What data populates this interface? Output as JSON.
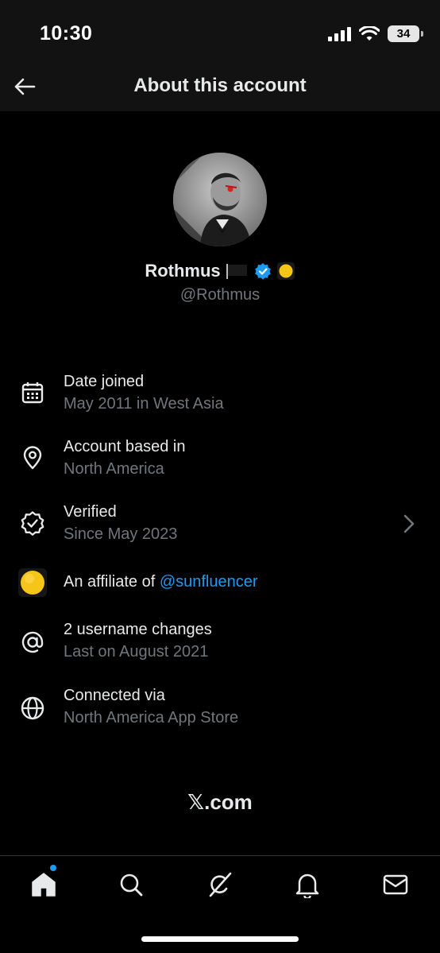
{
  "status_bar": {
    "time": "10:30",
    "battery": "34"
  },
  "header": {
    "title": "About this account"
  },
  "profile": {
    "name": "Rothmus",
    "handle": "@Rothmus"
  },
  "info": {
    "date_joined": {
      "title": "Date joined",
      "sub": "May 2011 in West Asia",
      "icon": "calendar-icon"
    },
    "based_in": {
      "title": "Account based in",
      "sub": "North America",
      "icon": "location-pin-icon"
    },
    "verified": {
      "title": "Verified",
      "sub": "Since May 2023",
      "icon": "verified-badge-icon"
    },
    "affiliate": {
      "prefix": "An affiliate of",
      "handle": "@sunfluencer",
      "icon": "sun-badge-icon"
    },
    "username_changes": {
      "title": "2 username changes",
      "sub": "Last on August 2021",
      "icon": "at-sign-icon"
    },
    "connected": {
      "title": "Connected via",
      "sub": "North America App Store",
      "icon": "globe-icon"
    }
  },
  "footer": {
    "brand": "𝕏.com"
  },
  "tabs": [
    "home-icon",
    "search-icon",
    "grok-icon",
    "notifications-icon",
    "messages-icon"
  ],
  "colors": {
    "accent": "#1d9bf0",
    "muted": "#71767b",
    "text": "#e7e9ea",
    "badge_gold": "#f5c518"
  }
}
